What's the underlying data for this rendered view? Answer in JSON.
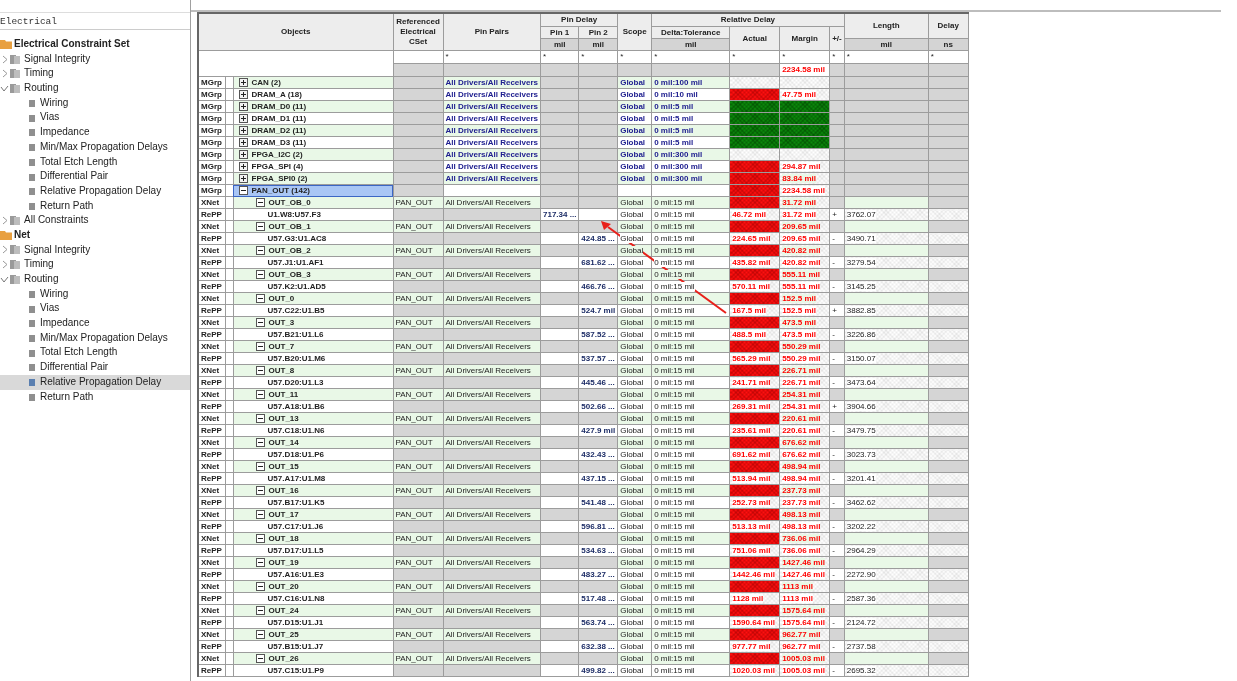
{
  "sidebar": {
    "field": "Electrical",
    "tree": [
      {
        "label": "Electrical Constraint Set",
        "kind": "folder",
        "selected": false,
        "children": [
          {
            "label": "Signal Integrity",
            "kind": "group",
            "expanded": false,
            "selected": false
          },
          {
            "label": "Timing",
            "kind": "group",
            "expanded": false,
            "selected": false
          },
          {
            "label": "Routing",
            "kind": "group",
            "expanded": true,
            "selected": false,
            "children": [
              {
                "label": "Wiring",
                "kind": "sheet",
                "selected": false
              },
              {
                "label": "Vias",
                "kind": "sheet",
                "selected": false
              },
              {
                "label": "Impedance",
                "kind": "sheet",
                "selected": false
              },
              {
                "label": "Min/Max Propagation Delays",
                "kind": "sheet",
                "selected": false
              },
              {
                "label": "Total Etch Length",
                "kind": "sheet",
                "selected": false
              },
              {
                "label": "Differential Pair",
                "kind": "sheet",
                "selected": false
              },
              {
                "label": "Relative Propagation Delay",
                "kind": "sheet",
                "selected": false
              },
              {
                "label": "Return Path",
                "kind": "sheet",
                "selected": false
              }
            ]
          },
          {
            "label": "All Constraints",
            "kind": "group",
            "expanded": false,
            "selected": false
          }
        ]
      },
      {
        "label": "Net",
        "kind": "folder",
        "selected": false,
        "children": [
          {
            "label": "Signal Integrity",
            "kind": "group",
            "expanded": false,
            "selected": false
          },
          {
            "label": "Timing",
            "kind": "group",
            "expanded": false,
            "selected": false
          },
          {
            "label": "Routing",
            "kind": "group",
            "expanded": true,
            "selected": false,
            "children": [
              {
                "label": "Wiring",
                "kind": "sheet",
                "selected": false
              },
              {
                "label": "Vias",
                "kind": "sheet",
                "selected": false
              },
              {
                "label": "Impedance",
                "kind": "sheet",
                "selected": false
              },
              {
                "label": "Min/Max Propagation Delays",
                "kind": "sheet",
                "selected": false
              },
              {
                "label": "Total Etch Length",
                "kind": "sheet",
                "selected": false
              },
              {
                "label": "Differential Pair",
                "kind": "sheet",
                "selected": false
              },
              {
                "label": "Relative Propagation Delay",
                "kind": "sheet",
                "selected": true
              },
              {
                "label": "Return Path",
                "kind": "sheet",
                "selected": false
              }
            ]
          }
        ]
      }
    ]
  },
  "table": {
    "header": {
      "objects": "Objects",
      "ref_cset": "Referenced Electrical CSet",
      "pin_pairs": "Pin Pairs",
      "pin_delay": "Pin Delay",
      "pin1": "Pin 1",
      "pin2": "Pin 2",
      "scope": "Scope",
      "relative_delay": "Relative Delay",
      "delta": "Delta:Tolerance",
      "actual": "Actual",
      "margin": "Margin",
      "sign": "+/-",
      "length": "Length",
      "delay": "Delay"
    },
    "units": {
      "pin1": "mil",
      "pin2": "mil",
      "delta": "mil",
      "length": "mil",
      "delay": "ns"
    },
    "filters": {
      "pin_pairs": "*",
      "pin1": "*",
      "pin2": "*",
      "scope": "*",
      "delta": "*",
      "actual": "*",
      "margin": "*",
      "sign": "*",
      "length": "*",
      "delay": "*"
    },
    "summary": {
      "margin": "2234.58 mil"
    },
    "rows": [
      {
        "kind": "mgrp",
        "type": "MGrp",
        "name": "CAN (2)",
        "expanded": false,
        "selected": false,
        "pin_pairs": "All Drivers/All Receivers",
        "scope": "Global",
        "delta": "0 mil:100 mil",
        "failed": false,
        "passed": false
      },
      {
        "kind": "mgrp",
        "type": "MGrp",
        "name": "DRAM_A (18)",
        "expanded": false,
        "selected": false,
        "pin_pairs": "All Drivers/All Receivers",
        "scope": "Global",
        "delta": "0 mil:10 mil",
        "failed": true,
        "passed": false,
        "margin": "47.75 mil"
      },
      {
        "kind": "mgrp",
        "type": "MGrp",
        "name": "DRAM_D0 (11)",
        "expanded": false,
        "selected": false,
        "pin_pairs": "All Drivers/All Receivers",
        "scope": "Global",
        "delta": "0 mil:5 mil",
        "failed": false,
        "passed": true
      },
      {
        "kind": "mgrp",
        "type": "MGrp",
        "name": "DRAM_D1 (11)",
        "expanded": false,
        "selected": false,
        "pin_pairs": "All Drivers/All Receivers",
        "scope": "Global",
        "delta": "0 mil:5 mil",
        "failed": false,
        "passed": true
      },
      {
        "kind": "mgrp",
        "type": "MGrp",
        "name": "DRAM_D2 (11)",
        "expanded": false,
        "selected": false,
        "pin_pairs": "All Drivers/All Receivers",
        "scope": "Global",
        "delta": "0 mil:5 mil",
        "failed": false,
        "passed": true
      },
      {
        "kind": "mgrp",
        "type": "MGrp",
        "name": "DRAM_D3 (11)",
        "expanded": false,
        "selected": false,
        "pin_pairs": "All Drivers/All Receivers",
        "scope": "Global",
        "delta": "0 mil:5 mil",
        "failed": false,
        "passed": true
      },
      {
        "kind": "mgrp",
        "type": "MGrp",
        "name": "FPGA_I2C (2)",
        "expanded": false,
        "selected": false,
        "pin_pairs": "All Drivers/All Receivers",
        "scope": "Global",
        "delta": "0 mil:300 mil",
        "failed": false,
        "passed": false
      },
      {
        "kind": "mgrp",
        "type": "MGrp",
        "name": "FPGA_SPI (4)",
        "expanded": false,
        "selected": false,
        "pin_pairs": "All Drivers/All Receivers",
        "scope": "Global",
        "delta": "0 mil:300 mil",
        "failed": true,
        "passed": false,
        "margin": "294.87 mil"
      },
      {
        "kind": "mgrp",
        "type": "MGrp",
        "name": "FPGA_SPI0 (2)",
        "expanded": false,
        "selected": false,
        "pin_pairs": "All Drivers/All Receivers",
        "scope": "Global",
        "delta": "0 mil:300 mil",
        "failed": true,
        "passed": false,
        "margin": "83.84 mil"
      },
      {
        "kind": "mgrp",
        "type": "MGrp",
        "name": "PAN_OUT (142)",
        "expanded": true,
        "selected": true,
        "failed": true,
        "passed": false,
        "margin": "2234.58 mil"
      },
      {
        "kind": "xnet",
        "type": "XNet",
        "name": "OUT_OB_0",
        "expanded": true,
        "selected": false,
        "ref_cset": "PAN_OUT",
        "pin_pairs": "All Drivers/All Receivers",
        "scope": "Global",
        "delta": "0 mil:15 mil",
        "failed": true,
        "passed": false,
        "margin": "31.72 mil"
      },
      {
        "kind": "repp",
        "type": "RePP",
        "name": "U1.W8:U57.F3",
        "selected": false,
        "pin1": "717.34 ...",
        "scope": "Global",
        "delta": "0 mil:15 mil",
        "failed": true,
        "passed": false,
        "actual": "46.72 mil",
        "margin": "31.72 mil",
        "sign": "+",
        "length": "3762.07"
      },
      {
        "kind": "xnet",
        "type": "XNet",
        "name": "OUT_OB_1",
        "expanded": true,
        "selected": false,
        "ref_cset": "PAN_OUT",
        "pin_pairs": "All Drivers/All Receivers",
        "scope": "Global",
        "delta": "0 mil:15 mil",
        "failed": true,
        "passed": false,
        "margin": "209.65 mil"
      },
      {
        "kind": "repp",
        "type": "RePP",
        "name": "U57.G3:U1.AC8",
        "selected": false,
        "pin2": "424.85 ...",
        "scope": "Global",
        "delta": "0 mil:15 mil",
        "failed": true,
        "passed": false,
        "actual": "224.65 mil",
        "margin": "209.65 mil",
        "sign": "-",
        "length": "3490.71"
      },
      {
        "kind": "xnet",
        "type": "XNet",
        "name": "OUT_OB_2",
        "expanded": true,
        "selected": false,
        "ref_cset": "PAN_OUT",
        "pin_pairs": "All Drivers/All Receivers",
        "scope": "Global",
        "delta": "0 mil:15 mil",
        "failed": true,
        "passed": false,
        "margin": "420.82 mil"
      },
      {
        "kind": "repp",
        "type": "RePP",
        "name": "U57.J1:U1.AF1",
        "selected": false,
        "pin2": "681.62 ...",
        "scope": "Global",
        "delta": "0 mil:15 mil",
        "failed": true,
        "passed": false,
        "actual": "435.82 mil",
        "margin": "420.82 mil",
        "sign": "-",
        "length": "3279.54"
      },
      {
        "kind": "xnet",
        "type": "XNet",
        "name": "OUT_OB_3",
        "expanded": true,
        "selected": false,
        "ref_cset": "PAN_OUT",
        "pin_pairs": "All Drivers/All Receivers",
        "scope": "Global",
        "delta": "0 mil:15 mil",
        "failed": true,
        "passed": false,
        "margin": "555.11 mil"
      },
      {
        "kind": "repp",
        "type": "RePP",
        "name": "U57.K2:U1.AD5",
        "selected": false,
        "pin2": "466.76 ...",
        "scope": "Global",
        "delta": "0 mil:15 mil",
        "failed": true,
        "passed": false,
        "actual": "570.11 mil",
        "margin": "555.11 mil",
        "sign": "-",
        "length": "3145.25"
      },
      {
        "kind": "xnet",
        "type": "XNet",
        "name": "OUT_0",
        "expanded": true,
        "selected": false,
        "ref_cset": "PAN_OUT",
        "pin_pairs": "All Drivers/All Receivers",
        "scope": "Global",
        "delta": "0 mil:15 mil",
        "failed": true,
        "passed": false,
        "margin": "152.5 mil"
      },
      {
        "kind": "repp",
        "type": "RePP",
        "name": "U57.C22:U1.B5",
        "selected": false,
        "pin2": "524.7 mil",
        "scope": "Global",
        "delta": "0 mil:15 mil",
        "failed": true,
        "passed": false,
        "actual": "167.5 mil",
        "margin": "152.5 mil",
        "sign": "+",
        "length": "3882.85"
      },
      {
        "kind": "xnet",
        "type": "XNet",
        "name": "OUT_3",
        "expanded": true,
        "selected": false,
        "ref_cset": "PAN_OUT",
        "pin_pairs": "All Drivers/All Receivers",
        "scope": "Global",
        "delta": "0 mil:15 mil",
        "failed": true,
        "passed": false,
        "margin": "473.5 mil"
      },
      {
        "kind": "repp",
        "type": "RePP",
        "name": "U57.B21:U1.L6",
        "selected": false,
        "pin2": "587.52 ...",
        "scope": "Global",
        "delta": "0 mil:15 mil",
        "failed": true,
        "passed": false,
        "actual": "488.5 mil",
        "margin": "473.5 mil",
        "sign": "-",
        "length": "3226.86"
      },
      {
        "kind": "xnet",
        "type": "XNet",
        "name": "OUT_7",
        "expanded": true,
        "selected": false,
        "ref_cset": "PAN_OUT",
        "pin_pairs": "All Drivers/All Receivers",
        "scope": "Global",
        "delta": "0 mil:15 mil",
        "failed": true,
        "passed": false,
        "margin": "550.29 mil"
      },
      {
        "kind": "repp",
        "type": "RePP",
        "name": "U57.B20:U1.M6",
        "selected": false,
        "pin2": "537.57 ...",
        "scope": "Global",
        "delta": "0 mil:15 mil",
        "failed": true,
        "passed": false,
        "actual": "565.29 mil",
        "margin": "550.29 mil",
        "sign": "-",
        "length": "3150.07"
      },
      {
        "kind": "xnet",
        "type": "XNet",
        "name": "OUT_8",
        "expanded": true,
        "selected": false,
        "ref_cset": "PAN_OUT",
        "pin_pairs": "All Drivers/All Receivers",
        "scope": "Global",
        "delta": "0 mil:15 mil",
        "failed": true,
        "passed": false,
        "margin": "226.71 mil"
      },
      {
        "kind": "repp",
        "type": "RePP",
        "name": "U57.D20:U1.L3",
        "selected": false,
        "pin2": "445.46 ...",
        "scope": "Global",
        "delta": "0 mil:15 mil",
        "failed": true,
        "passed": false,
        "actual": "241.71 mil",
        "margin": "226.71 mil",
        "sign": "-",
        "length": "3473.64"
      },
      {
        "kind": "xnet",
        "type": "XNet",
        "name": "OUT_11",
        "expanded": true,
        "selected": false,
        "ref_cset": "PAN_OUT",
        "pin_pairs": "All Drivers/All Receivers",
        "scope": "Global",
        "delta": "0 mil:15 mil",
        "failed": true,
        "passed": false,
        "margin": "254.31 mil"
      },
      {
        "kind": "repp",
        "type": "RePP",
        "name": "U57.A18:U1.B6",
        "selected": false,
        "pin2": "502.66 ...",
        "scope": "Global",
        "delta": "0 mil:15 mil",
        "failed": true,
        "passed": false,
        "actual": "269.31 mil",
        "margin": "254.31 mil",
        "sign": "+",
        "length": "3904.66"
      },
      {
        "kind": "xnet",
        "type": "XNet",
        "name": "OUT_13",
        "expanded": true,
        "selected": false,
        "ref_cset": "PAN_OUT",
        "pin_pairs": "All Drivers/All Receivers",
        "scope": "Global",
        "delta": "0 mil:15 mil",
        "failed": true,
        "passed": false,
        "margin": "220.61 mil"
      },
      {
        "kind": "repp",
        "type": "RePP",
        "name": "U57.C18:U1.N6",
        "selected": false,
        "pin2": "427.9 mil",
        "scope": "Global",
        "delta": "0 mil:15 mil",
        "failed": true,
        "passed": false,
        "actual": "235.61 mil",
        "margin": "220.61 mil",
        "sign": "-",
        "length": "3479.75"
      },
      {
        "kind": "xnet",
        "type": "XNet",
        "name": "OUT_14",
        "expanded": true,
        "selected": false,
        "ref_cset": "PAN_OUT",
        "pin_pairs": "All Drivers/All Receivers",
        "scope": "Global",
        "delta": "0 mil:15 mil",
        "failed": true,
        "passed": false,
        "margin": "676.62 mil"
      },
      {
        "kind": "repp",
        "type": "RePP",
        "name": "U57.D18:U1.P6",
        "selected": false,
        "pin2": "432.43 ...",
        "scope": "Global",
        "delta": "0 mil:15 mil",
        "failed": true,
        "passed": false,
        "actual": "691.62 mil",
        "margin": "676.62 mil",
        "sign": "-",
        "length": "3023.73"
      },
      {
        "kind": "xnet",
        "type": "XNet",
        "name": "OUT_15",
        "expanded": true,
        "selected": false,
        "ref_cset": "PAN_OUT",
        "pin_pairs": "All Drivers/All Receivers",
        "scope": "Global",
        "delta": "0 mil:15 mil",
        "failed": true,
        "passed": false,
        "margin": "498.94 mil"
      },
      {
        "kind": "repp",
        "type": "RePP",
        "name": "U57.A17:U1.M8",
        "selected": false,
        "pin2": "437.15 ...",
        "scope": "Global",
        "delta": "0 mil:15 mil",
        "failed": true,
        "passed": false,
        "actual": "513.94 mil",
        "margin": "498.94 mil",
        "sign": "-",
        "length": "3201.41"
      },
      {
        "kind": "xnet",
        "type": "XNet",
        "name": "OUT_16",
        "expanded": true,
        "selected": false,
        "ref_cset": "PAN_OUT",
        "pin_pairs": "All Drivers/All Receivers",
        "scope": "Global",
        "delta": "0 mil:15 mil",
        "failed": true,
        "passed": false,
        "margin": "237.73 mil"
      },
      {
        "kind": "repp",
        "type": "RePP",
        "name": "U57.B17:U1.K5",
        "selected": false,
        "pin2": "541.48 ...",
        "scope": "Global",
        "delta": "0 mil:15 mil",
        "failed": true,
        "passed": false,
        "actual": "252.73 mil",
        "margin": "237.73 mil",
        "sign": "-",
        "length": "3462.62"
      },
      {
        "kind": "xnet",
        "type": "XNet",
        "name": "OUT_17",
        "expanded": true,
        "selected": false,
        "ref_cset": "PAN_OUT",
        "pin_pairs": "All Drivers/All Receivers",
        "scope": "Global",
        "delta": "0 mil:15 mil",
        "failed": true,
        "passed": false,
        "margin": "498.13 mil"
      },
      {
        "kind": "repp",
        "type": "RePP",
        "name": "U57.C17:U1.J6",
        "selected": false,
        "pin2": "596.81 ...",
        "scope": "Global",
        "delta": "0 mil:15 mil",
        "failed": true,
        "passed": false,
        "actual": "513.13 mil",
        "margin": "498.13 mil",
        "sign": "-",
        "length": "3202.22"
      },
      {
        "kind": "xnet",
        "type": "XNet",
        "name": "OUT_18",
        "expanded": true,
        "selected": false,
        "ref_cset": "PAN_OUT",
        "pin_pairs": "All Drivers/All Receivers",
        "scope": "Global",
        "delta": "0 mil:15 mil",
        "failed": true,
        "passed": false,
        "margin": "736.06 mil"
      },
      {
        "kind": "repp",
        "type": "RePP",
        "name": "U57.D17:U1.L5",
        "selected": false,
        "pin2": "534.63 ...",
        "scope": "Global",
        "delta": "0 mil:15 mil",
        "failed": true,
        "passed": false,
        "actual": "751.06 mil",
        "margin": "736.06 mil",
        "sign": "-",
        "length": "2964.29"
      },
      {
        "kind": "xnet",
        "type": "XNet",
        "name": "OUT_19",
        "expanded": true,
        "selected": false,
        "ref_cset": "PAN_OUT",
        "pin_pairs": "All Drivers/All Receivers",
        "scope": "Global",
        "delta": "0 mil:15 mil",
        "failed": true,
        "passed": false,
        "margin": "1427.46 mil"
      },
      {
        "kind": "repp",
        "type": "RePP",
        "name": "U57.A16:U1.E3",
        "selected": false,
        "pin2": "483.27 ...",
        "scope": "Global",
        "delta": "0 mil:15 mil",
        "failed": true,
        "passed": false,
        "actual": "1442.46 mil",
        "margin": "1427.46 mil",
        "sign": "-",
        "length": "2272.90"
      },
      {
        "kind": "xnet",
        "type": "XNet",
        "name": "OUT_20",
        "expanded": true,
        "selected": false,
        "ref_cset": "PAN_OUT",
        "pin_pairs": "All Drivers/All Receivers",
        "scope": "Global",
        "delta": "0 mil:15 mil",
        "failed": true,
        "passed": false,
        "margin": "1113 mil"
      },
      {
        "kind": "repp",
        "type": "RePP",
        "name": "U57.C16:U1.N8",
        "selected": false,
        "pin2": "517.48 ...",
        "scope": "Global",
        "delta": "0 mil:15 mil",
        "failed": true,
        "passed": false,
        "actual": "1128 mil",
        "margin": "1113 mil",
        "sign": "-",
        "length": "2587.36"
      },
      {
        "kind": "xnet",
        "type": "XNet",
        "name": "OUT_24",
        "expanded": true,
        "selected": false,
        "ref_cset": "PAN_OUT",
        "pin_pairs": "All Drivers/All Receivers",
        "scope": "Global",
        "delta": "0 mil:15 mil",
        "failed": true,
        "passed": false,
        "margin": "1575.64 mil"
      },
      {
        "kind": "repp",
        "type": "RePP",
        "name": "U57.D15:U1.J1",
        "selected": false,
        "pin2": "563.74 ...",
        "scope": "Global",
        "delta": "0 mil:15 mil",
        "failed": true,
        "passed": false,
        "actual": "1590.64 mil",
        "margin": "1575.64 mil",
        "sign": "-",
        "length": "2124.72"
      },
      {
        "kind": "xnet",
        "type": "XNet",
        "name": "OUT_25",
        "expanded": true,
        "selected": false,
        "ref_cset": "PAN_OUT",
        "pin_pairs": "All Drivers/All Receivers",
        "scope": "Global",
        "delta": "0 mil:15 mil",
        "failed": true,
        "passed": false,
        "margin": "962.77 mil"
      },
      {
        "kind": "repp",
        "type": "RePP",
        "name": "U57.B15:U1.J7",
        "selected": false,
        "pin2": "632.38 ...",
        "scope": "Global",
        "delta": "0 mil:15 mil",
        "failed": true,
        "passed": false,
        "actual": "977.77 mil",
        "margin": "962.77 mil",
        "sign": "-",
        "length": "2737.58"
      },
      {
        "kind": "xnet",
        "type": "XNet",
        "name": "OUT_26",
        "expanded": true,
        "selected": false,
        "ref_cset": "PAN_OUT",
        "pin_pairs": "All Drivers/All Receivers",
        "scope": "Global",
        "delta": "0 mil:15 mil",
        "failed": true,
        "passed": false,
        "margin": "1005.03 mil"
      },
      {
        "kind": "repp",
        "type": "RePP",
        "name": "U57.C15:U1.P9",
        "selected": false,
        "pin2": "499.82 ...",
        "scope": "Global",
        "delta": "0 mil:15 mil",
        "failed": true,
        "passed": false,
        "actual": "1020.03 mil",
        "margin": "1005.03 mil",
        "sign": "-",
        "length": "2695.32"
      }
    ]
  }
}
